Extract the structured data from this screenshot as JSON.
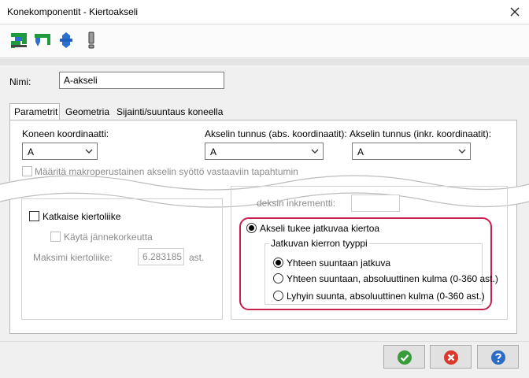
{
  "window": {
    "title": "Konekomponentit - Kiertoakseli"
  },
  "toolbar": {
    "icons": [
      "component-green-icon",
      "component-blue-green-icon",
      "gear-axis-icon",
      "warning-exclamation-icon"
    ]
  },
  "name_field": {
    "label": "Nimi:",
    "value": "A-akseli"
  },
  "tabs": [
    {
      "label": "Parametrit",
      "active": true
    },
    {
      "label": "Geometria",
      "active": false
    },
    {
      "label": "Sijainti/suuntaus koneella",
      "active": false
    }
  ],
  "params": {
    "machine_coord": {
      "label": "Koneen koordinaatti:",
      "value": "A"
    },
    "axis_abs": {
      "label": "Akselin tunnus (abs. koordinaatit):",
      "value": "A"
    },
    "axis_inc": {
      "label": "Akselin tunnus (inkr. koordinaatit):",
      "value": "A"
    },
    "macro_checkbox": {
      "label": "Määritä makroperustainen akselin syöttö vastaaviin tapahtumin"
    },
    "increment_fragment": "deksin inkrementti:",
    "cut_rotation": {
      "label": "Katkaise kiertoliike"
    },
    "use_chord": {
      "label": "Käytä jännekorkeutta"
    },
    "max_rotation": {
      "label": "Maksimi kiertoliike:",
      "value": "6.283185",
      "unit": "ast."
    },
    "continuous": {
      "label": "Akseli tukee jatkuvaa kiertoa",
      "checked": true
    },
    "rotation_type": {
      "group_label": "Jatkuvan kierron tyyppi",
      "options": [
        {
          "label": "Yhteen suuntaan jatkuva",
          "checked": true
        },
        {
          "label": "Yhteen suuntaan, absoluuttinen kulma (0-360 ast.)",
          "checked": false
        },
        {
          "label": "Lyhyin suunta, absoluuttinen kulma (0-360 ast.)",
          "checked": false
        }
      ]
    }
  },
  "buttons": {
    "ok_icon": "check-icon",
    "cancel_icon": "cancel-x-icon",
    "help_icon": "help-question-icon"
  },
  "colors": {
    "accent_highlight": "#c8204f",
    "ok_green": "#3a9b3a",
    "cancel_red": "#d9392b",
    "help_blue": "#2b6cc4"
  }
}
